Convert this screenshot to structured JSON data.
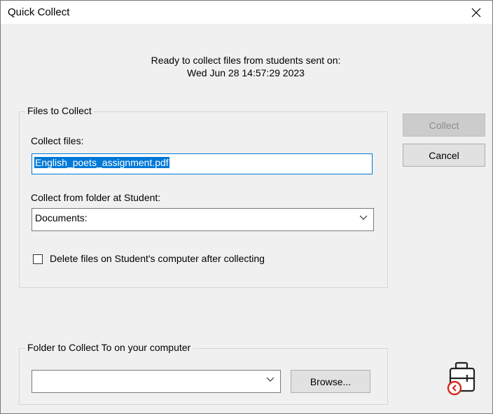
{
  "window": {
    "title": "Quick Collect",
    "close_icon": "close-icon"
  },
  "info": {
    "line1": "Ready to collect files from students sent on:",
    "line2": "Wed Jun 28 14:57:29 2023"
  },
  "files_group": {
    "legend": "Files to Collect",
    "collect_files_label": "Collect files:",
    "collect_files_value": "English_poets_assignment.pdf",
    "collect_from_label": "Collect from folder at Student:",
    "collect_from_value": "Documents:",
    "delete_checkbox_label": "Delete files on Student's computer after collecting",
    "delete_checked": false
  },
  "buttons": {
    "collect": "Collect",
    "collect_enabled": false,
    "cancel": "Cancel"
  },
  "dest_group": {
    "legend": "Folder to Collect To on your computer",
    "folder_value": "",
    "browse": "Browse..."
  },
  "icons": {
    "combo_chevron": "chevron-down-icon",
    "collect_badge": "briefcase-collect-icon"
  },
  "colors": {
    "selection": "#0078d7",
    "badge_red": "#d42a20"
  }
}
